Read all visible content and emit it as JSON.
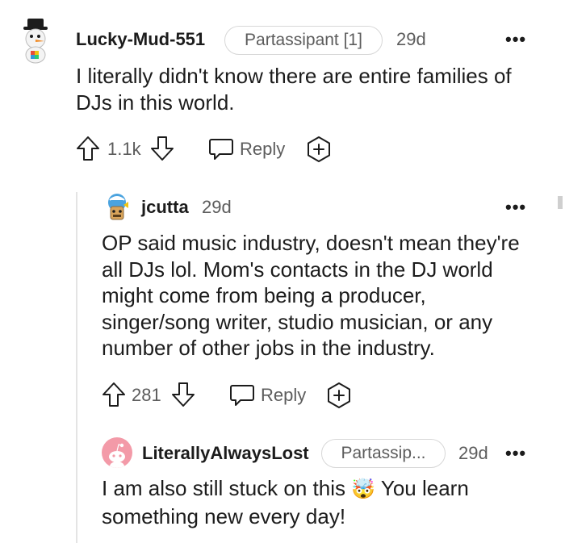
{
  "comments": [
    {
      "username": "Lucky-Mud-551",
      "flair": "Partassipant [1]",
      "age": "29d",
      "body": "I literally didn't know there are entire families of DJs in this world.",
      "score": "1.1k",
      "reply_label": "Reply"
    },
    {
      "username": "jcutta",
      "age": "29d",
      "body": "OP said music industry, doesn't mean they're all DJs lol. Mom's contacts in the DJ world might come from being a producer, singer/song writer, studio musician, or any number of other jobs in the industry.",
      "score": "281",
      "reply_label": "Reply"
    },
    {
      "username": "LiterallyAlwaysLost",
      "flair": "Partassip...",
      "age": "29d",
      "body_before": "I am also still stuck on this",
      "emoji": "🤯",
      "body_after": "You learn something new every day!"
    }
  ],
  "more_glyph": "•••",
  "colors": {
    "text": "#1c1c1c",
    "muted": "#5c5c5c",
    "thread_line": "#e4e4e4",
    "avatar_pink": "#f39aa8"
  }
}
